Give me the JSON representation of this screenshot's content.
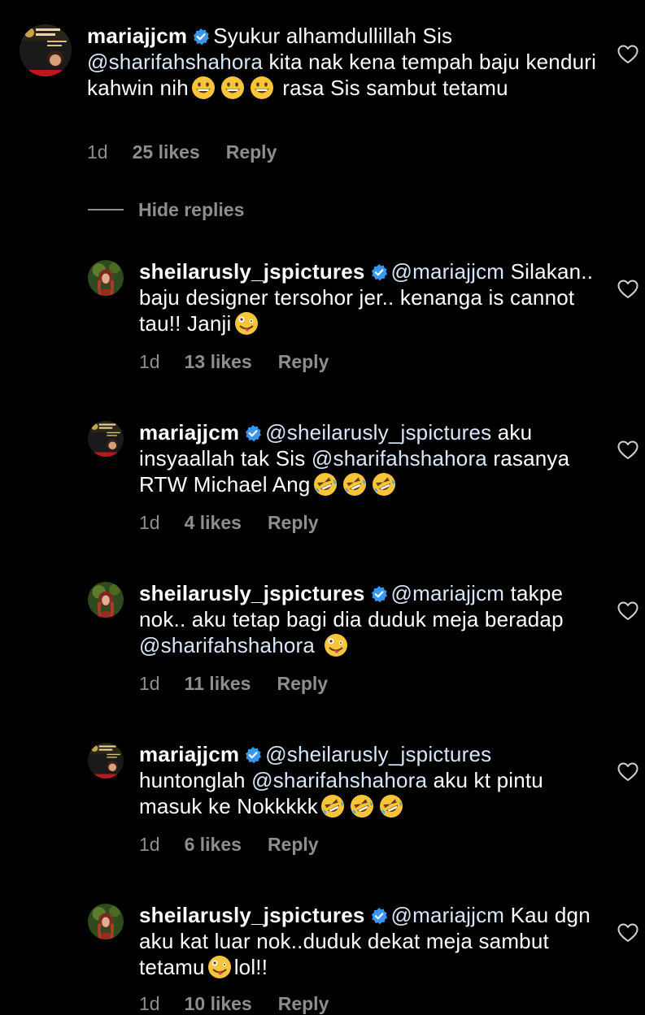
{
  "colors": {
    "background": "#000000",
    "text": "#ffffff",
    "muted": "#8e8e8e",
    "verified": "#3897f0"
  },
  "comments": [
    {
      "username": "mariajjcm",
      "avatar": "mariajjcm-avatar",
      "verified": true,
      "parts": [
        {
          "t": "Syukur alhamdullillah Sis "
        },
        {
          "m": "@sharifahshahora"
        },
        {
          "t": " kita nak kena tempah baju kenduri kahwin nih"
        },
        {
          "e": "grinning"
        },
        {
          "e": "grinning"
        },
        {
          "e": "grinning"
        },
        {
          "t": " rasa Sis sambut tetamu"
        }
      ],
      "time": "1d",
      "likes": "25 likes",
      "reply": "Reply"
    },
    {
      "username": "sheilarusly_jspictures",
      "avatar": "sheilarusly-avatar",
      "verified": true,
      "parts": [
        {
          "m": "@mariajjcm"
        },
        {
          "t": " Silakan.. baju designer tersohor jer.. kenanga is cannot tau!! Janji"
        },
        {
          "e": "zany"
        }
      ],
      "time": "1d",
      "likes": "13 likes",
      "reply": "Reply"
    },
    {
      "username": "mariajjcm",
      "avatar": "mariajjcm-avatar",
      "verified": true,
      "parts": [
        {
          "m": "@sheilarusly_jspictures"
        },
        {
          "t": " aku insyaallah tak Sis "
        },
        {
          "m": "@sharifahshahora"
        },
        {
          "t": " rasanya RTW Michael Ang"
        },
        {
          "e": "rofl"
        },
        {
          "e": "rofl"
        },
        {
          "e": "rofl"
        }
      ],
      "time": "1d",
      "likes": "4 likes",
      "reply": "Reply"
    },
    {
      "username": "sheilarusly_jspictures",
      "avatar": "sheilarusly-avatar",
      "verified": true,
      "parts": [
        {
          "m": "@mariajjcm"
        },
        {
          "t": " takpe nok.. aku tetap bagi dia duduk meja beradap "
        },
        {
          "m": "@sharifahshahora"
        },
        {
          "t": " "
        },
        {
          "e": "zany"
        }
      ],
      "time": "1d",
      "likes": "11 likes",
      "reply": "Reply"
    },
    {
      "username": "mariajjcm",
      "avatar": "mariajjcm-avatar",
      "verified": true,
      "parts": [
        {
          "m": "@sheilarusly_jspictures"
        },
        {
          "t": " huntonglah "
        },
        {
          "m": "@sharifahshahora"
        },
        {
          "t": " aku kt pintu masuk ke Nokkkkk"
        },
        {
          "e": "rofl"
        },
        {
          "e": "rofl"
        },
        {
          "e": "rofl"
        }
      ],
      "time": "1d",
      "likes": "6 likes",
      "reply": "Reply"
    },
    {
      "username": "sheilarusly_jspictures",
      "avatar": "sheilarusly-avatar",
      "verified": true,
      "parts": [
        {
          "m": "@mariajjcm"
        },
        {
          "t": " Kau dgn aku kat luar nok..duduk dekat meja sambut tetamu"
        },
        {
          "e": "zany"
        },
        {
          "t": "lol!!"
        }
      ],
      "time": "1d",
      "likes": "10 likes",
      "reply": "Reply"
    }
  ],
  "hide_replies": "Hide replies",
  "icons": {
    "verified": "verified-badge-icon",
    "like": "heart-outline-icon",
    "emoji_grinning": "grinning-face-emoji",
    "emoji_zany": "zany-face-emoji",
    "emoji_rofl": "rolling-on-floor-laughing-emoji"
  }
}
